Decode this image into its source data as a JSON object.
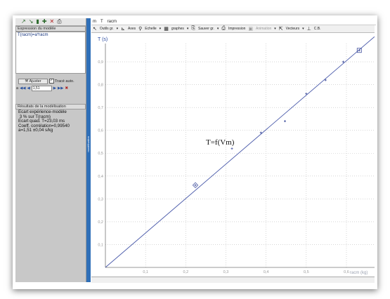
{
  "left_panel": {
    "toolbar_icons": [
      "↗",
      "↘",
      "▮",
      "✚",
      "✕",
      "⎙"
    ],
    "model_header": "Expression du modèle",
    "model_expression": "T(racm)=a*racm",
    "adjust_button": "Ajuster",
    "auto_trace_label": "Tracé auto.",
    "param_label": "a",
    "param_value": "1,51",
    "results_header": "Résultats de la modélisation",
    "results_lines": [
      "Ecart expérience-modèle",
      " 3 % sur T(racm)",
      "Ecart quad. T=23,03 ms",
      "Coeff. corrélation=0,99540",
      "",
      "a=1,51 ±0,04 s/kg"
    ],
    "side_tab": "modélisation"
  },
  "menu": {
    "items": [
      "m",
      "T",
      "racm"
    ]
  },
  "toolbar": {
    "outils": "Outils gr.",
    "axes": "Axes",
    "echelle": "Echelle",
    "graphes": "graphes",
    "sauver": "Sauver gr.",
    "impression": "Impression",
    "animation": "Animation",
    "vecteurs": "Vecteurs",
    "cb": "C.B."
  },
  "chart_data": {
    "type": "scatter",
    "title": "T=f(Vm)",
    "ylabel": "T (s)",
    "xlabel": "racm (kg)",
    "xlim": [
      0,
      0.67
    ],
    "ylim": [
      0,
      0.98
    ],
    "x_ticks": [
      "0,1",
      "0,2",
      "0,3",
      "0,4",
      "0,5",
      "0,6"
    ],
    "y_ticks": [
      "0,1",
      "0,2",
      "0,3",
      "0,4",
      "0,5",
      "0,6",
      "0,7",
      "0,8",
      "0,9"
    ],
    "grid": true,
    "points": [
      {
        "x": 0.224,
        "y": 0.36
      },
      {
        "x": 0.315,
        "y": 0.52
      },
      {
        "x": 0.387,
        "y": 0.59
      },
      {
        "x": 0.447,
        "y": 0.64
      },
      {
        "x": 0.5,
        "y": 0.76
      },
      {
        "x": 0.548,
        "y": 0.82
      },
      {
        "x": 0.592,
        "y": 0.9
      },
      {
        "x": 0.632,
        "y": 0.95
      }
    ],
    "model_line": {
      "x": [
        0,
        0.67
      ],
      "y": [
        0,
        1.01
      ]
    },
    "colors": {
      "points": "#3a4a9a",
      "line": "#4a5aaa",
      "grid": "#bdbdbd"
    }
  }
}
